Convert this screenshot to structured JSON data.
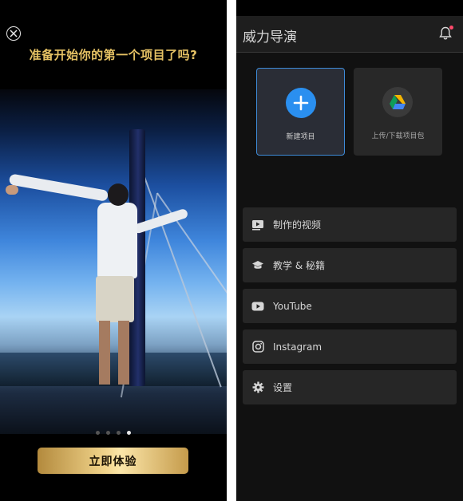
{
  "left_screen": {
    "title": "准备开始你的第一个项目了吗?",
    "page_dots": 4,
    "active_dot": 4,
    "cta_label": "立即体验"
  },
  "right_screen": {
    "app_title": "威力导演",
    "tiles": [
      {
        "label": "新建项目",
        "icon": "plus-icon"
      },
      {
        "label": "上传/下载项目包",
        "icon": "google-drive-icon"
      }
    ],
    "menu": [
      {
        "label": "制作的视频",
        "icon": "video-icon"
      },
      {
        "label": "教学 & 秘籍",
        "icon": "graduation-cap-icon"
      },
      {
        "label": "YouTube",
        "icon": "youtube-icon"
      },
      {
        "label": "Instagram",
        "icon": "instagram-icon"
      },
      {
        "label": "设置",
        "icon": "gear-icon"
      }
    ]
  },
  "colors": {
    "gold_title": "#e6c264",
    "accent_blue": "#2a8ff0",
    "notification_dot": "#ff4a6b"
  }
}
